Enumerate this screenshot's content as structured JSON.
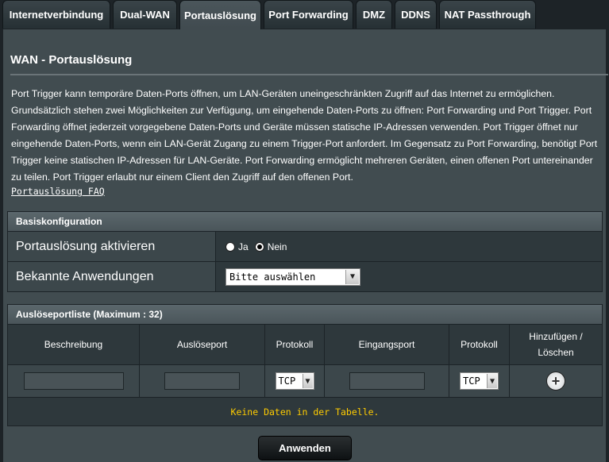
{
  "tabs": [
    {
      "label": "Internetverbindung"
    },
    {
      "label": "Dual-WAN"
    },
    {
      "label": "Portauslösung"
    },
    {
      "label": "Port Forwarding"
    },
    {
      "label": "DMZ"
    },
    {
      "label": "DDNS"
    },
    {
      "label": "NAT Passthrough"
    }
  ],
  "active_tab": "Portauslösung",
  "page": {
    "title": "WAN - Portauslösung",
    "description": "Port Trigger kann temporäre Daten-Ports öffnen, um LAN-Geräten uneingeschränkten Zugriff auf das Internet zu ermöglichen. Grundsätzlich stehen zwei Möglichkeiten zur Verfügung, um eingehende Daten-Ports zu öffnen: Port Forwarding und Port Trigger. Port Forwarding öffnet jederzeit vorgegebene Daten-Ports und Geräte müssen statische IP-Adressen verwenden. Port Trigger öffnet nur eingehende Daten-Ports, wenn ein LAN-Gerät Zugang zu einem Trigger-Port anfordert. Im Gegensatz zu Port Forwarding, benötigt Port Trigger keine statischen IP-Adressen für LAN-Geräte. Port Forwarding ermöglicht mehreren Geräten, einen offenen Port untereinander zu teilen. Port Trigger erlaubt nur einem Client den Zugriff auf den offenen Port.",
    "faq_link": "Portauslösung FAQ"
  },
  "basic": {
    "header": "Basiskonfiguration",
    "enable_label": "Portauslösung aktivieren",
    "option_yes": "Ja",
    "option_no": "Nein",
    "selected": "Nein",
    "apps_label": "Bekannte Anwendungen",
    "apps_value": "Bitte auswählen"
  },
  "trigger_list": {
    "header": "Auslöseportliste (Maximum : 32)",
    "columns": [
      "Beschreibung",
      "Auslöseport",
      "Protokoll",
      "Eingangsport",
      "Protokoll",
      "Hinzufügen /\nLöschen"
    ],
    "col_add_line1": "Hinzufügen /",
    "col_add_line2": "Löschen",
    "protocol_trigger": "TCP",
    "protocol_incoming": "TCP",
    "empty_text": "Keine Daten in der Tabelle."
  },
  "apply_label": "Anwenden",
  "icons": {
    "add": "plus-circle-icon",
    "dropdown": "chevron-down-icon"
  }
}
